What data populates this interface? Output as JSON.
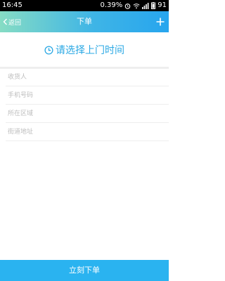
{
  "status_bar": {
    "time": "16:45",
    "network_speed": "0.39",
    "network_unit": "%",
    "battery_level": "91",
    "icons": [
      "alarm-icon",
      "wifi-icon",
      "signal-icon",
      "battery-icon"
    ]
  },
  "nav": {
    "back_label": "返回",
    "title": "下单",
    "add_icon": "plus-icon"
  },
  "time_select": {
    "label": "请选择上门时间",
    "icon": "clock-icon"
  },
  "form": {
    "receiver_placeholder": "收货人",
    "phone_placeholder": "手机号码",
    "region_placeholder": "所在区域",
    "street_placeholder": "街道地址"
  },
  "submit": {
    "label": "立刻下单"
  },
  "colors": {
    "accent": "#2aa8e4",
    "submit_bg": "#2ab3f0",
    "nav_gradient_start": "#86dcc4",
    "nav_gradient_end": "#27a5ee",
    "status_bar_bg": "#000000",
    "divider": "#eeeeee",
    "placeholder": "#bdbdbd"
  }
}
